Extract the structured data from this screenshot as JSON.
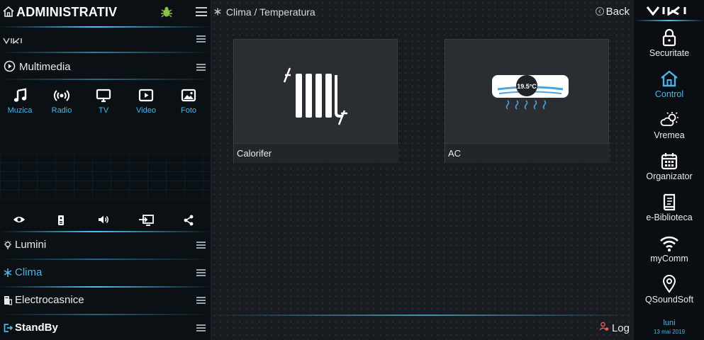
{
  "left_panel": {
    "title": "ADMINISTRATIV",
    "logo_text": "VIKI",
    "multimedia_label": "Multimedia",
    "media_items": [
      {
        "label": "Muzica",
        "icon": "music-note-icon"
      },
      {
        "label": "Radio",
        "icon": "radio-icon"
      },
      {
        "label": "TV",
        "icon": "tv-icon"
      },
      {
        "label": "Video",
        "icon": "video-icon"
      },
      {
        "label": "Foto",
        "icon": "photo-icon"
      }
    ],
    "control_icons": [
      "eye-icon",
      "remote-icon",
      "volume-icon",
      "input-source-icon",
      "share-icon"
    ],
    "categories": [
      {
        "label": "Lumini",
        "icon": "bulb-icon",
        "active": false
      },
      {
        "label": "Clima",
        "icon": "snowflake-icon",
        "active": true
      },
      {
        "label": "Electrocasnice",
        "icon": "appliance-icon",
        "active": false
      },
      {
        "label": "StandBy",
        "icon": "standby-icon",
        "active": false
      }
    ]
  },
  "main": {
    "breadcrumb": "Clima / Temperatura",
    "back_label": "Back",
    "log_label": "Log",
    "tiles": [
      {
        "caption": "Calorifer",
        "icon": "radiator-icon"
      },
      {
        "caption": "AC",
        "icon": "air-conditioner-icon",
        "temperature": "19.5°C"
      }
    ]
  },
  "right_panel": {
    "logo_text": "VIKI",
    "nav": [
      {
        "label": "Securitate",
        "icon": "lock-icon",
        "active": false
      },
      {
        "label": "Control",
        "icon": "home-icon",
        "active": true
      },
      {
        "label": "Vremea",
        "icon": "weather-icon",
        "active": false
      },
      {
        "label": "Organizator",
        "icon": "calendar-icon",
        "active": false
      },
      {
        "label": "e-Biblioteca",
        "icon": "book-icon",
        "active": false
      },
      {
        "label": "myComm",
        "icon": "wifi-icon",
        "active": false
      },
      {
        "label": "QSoundSoft",
        "icon": "location-pin-icon",
        "active": false
      }
    ],
    "day": "luni",
    "date": "13 mai 2019"
  },
  "colors": {
    "accent": "#4fb4e6",
    "panel_bg": "#0b1015",
    "main_bg": "#181c20",
    "tile_bg": "#2a2d31"
  }
}
